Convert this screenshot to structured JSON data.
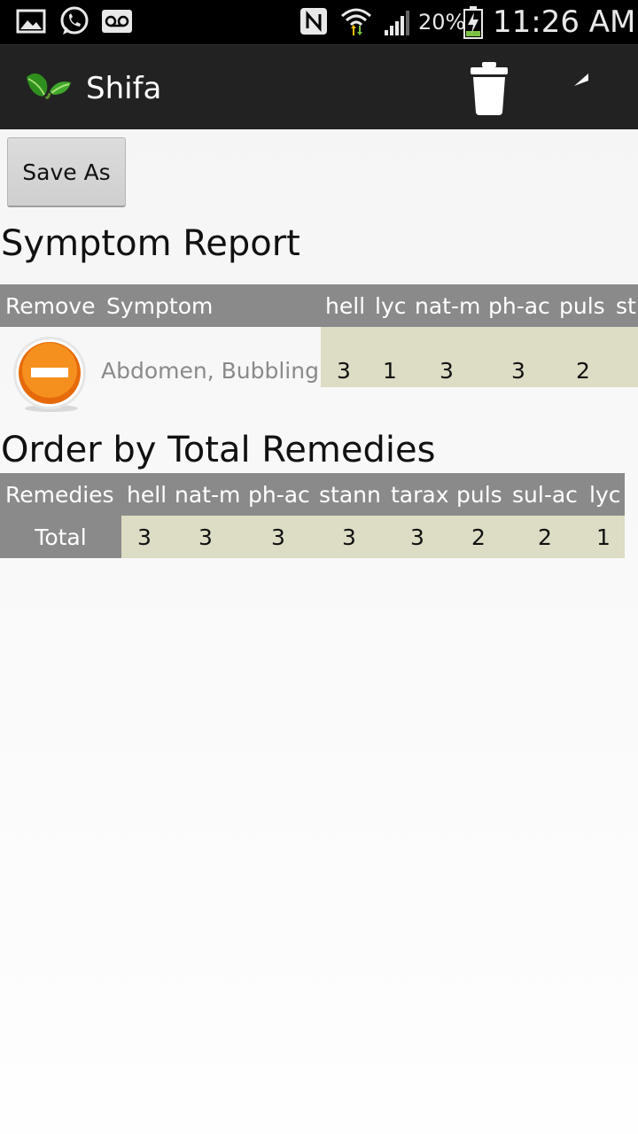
{
  "status_bar": {
    "time": "11:26 AM",
    "battery_percent": "20%",
    "icons": [
      "gallery-icon",
      "whatsapp-icon",
      "voicemail-icon",
      "nfc-icon",
      "wifi-icon",
      "signal-icon",
      "battery-charging-icon"
    ]
  },
  "action_bar": {
    "title": "Shifa",
    "logo_icon": "leaf-icon",
    "actions": [
      "trash-icon",
      "back-icon"
    ]
  },
  "save_as_label": "Save As",
  "symptom_report": {
    "title": "Symptom Report",
    "headers": {
      "remove": "Remove",
      "symptom": "Symptom",
      "remedies": [
        "hell",
        "lyc",
        "nat-m",
        "ph-ac",
        "puls",
        "st"
      ]
    },
    "rows": [
      {
        "symptom": "Abdomen, Bubbling",
        "values": [
          "3",
          "1",
          "3",
          "3",
          "2",
          ""
        ]
      }
    ]
  },
  "order_by_total": {
    "title": "Order by Total Remedies",
    "row_header": "Remedies",
    "row_label": "Total",
    "remedies": [
      "hell",
      "nat-m",
      "ph-ac",
      "stann",
      "tarax",
      "puls",
      "sul-ac",
      "lyc"
    ],
    "totals": [
      "3",
      "3",
      "3",
      "3",
      "3",
      "2",
      "2",
      "1"
    ]
  },
  "colors": {
    "action_bar": "#222222",
    "header_gray": "#8a8a8a",
    "value_cell": "#dddcc4",
    "remove_icon": "#f07c10"
  }
}
